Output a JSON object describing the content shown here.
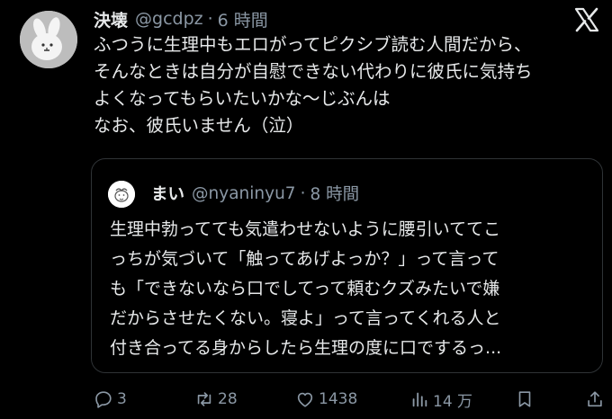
{
  "post": {
    "author_name": "決壊",
    "author_handle": "@gcdpz",
    "separator": "·",
    "time": "6 時間",
    "lines": [
      "ふつうに生理中もエロがってピクシブ読む人間だから、",
      "そんなときは自分が自慰できない代わりに彼氏に気持ち",
      "よくなってもらいたいかな〜じぶんは",
      "なお、彼氏いません（泣）"
    ]
  },
  "quote": {
    "author_name": "まい",
    "author_handle": "@nyaninyu7",
    "separator": "·",
    "time": "8 時間",
    "lines": [
      "生理中勃ってても気遣わせないように腰引いててこ",
      "っちが気づいて「触ってあげよっか？」って言って",
      "も「できないなら口でしてって頼むクズみたいで嫌",
      "だからさせたくない。寝よ」って言ってくれる人と",
      "付き合ってる身からしたら生理の度に口でするっ..."
    ]
  },
  "actions": {
    "replies": "3",
    "reposts": "28",
    "likes": "1438",
    "views": "14 万"
  },
  "icons": {
    "logo": "x-logo-icon",
    "reply": "reply-icon",
    "repost": "repost-icon",
    "like": "heart-icon",
    "views": "views-chart-icon",
    "bookmark": "bookmark-icon",
    "share": "share-icon"
  },
  "colors": {
    "background": "#000000",
    "text": "#e7e9ea",
    "secondary": "#8b98a5",
    "border": "#2f3336"
  }
}
